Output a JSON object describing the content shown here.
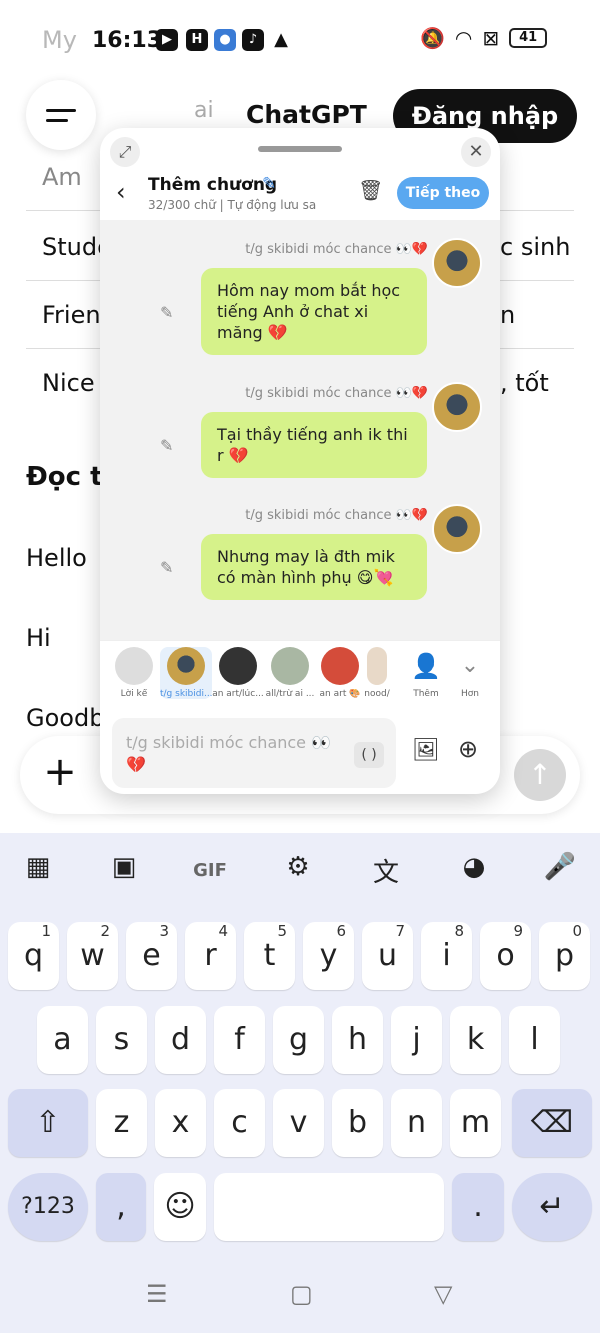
{
  "status": {
    "ghost": "My",
    "time": "16:13",
    "battery": "41",
    "apps": [
      "▶",
      "H",
      "●",
      "♪",
      "▲"
    ]
  },
  "background": {
    "ai_text": "ai",
    "title": "ChatGPT",
    "login_label": "Đăng nhập",
    "rows": [
      {
        "left": "Am",
        "right": ""
      },
      {
        "left": "Stude",
        "right": "c sinh"
      },
      {
        "left": "Frien",
        "right": "n"
      },
      {
        "left": "Nice",
        "right": ", tốt"
      }
    ],
    "section_title": "Đọc t",
    "words": [
      "Hello",
      "Hi",
      "Goodb"
    ]
  },
  "popup": {
    "title": "Thêm chương",
    "subtitle": "32/300 chữ | Tự động lưu sa",
    "next_label": "Tiếp theo",
    "messages": [
      {
        "name": "t/g skibidi móc chance 👀💔",
        "text": "Hôm nay mom bắt học tiếng Anh ở chat xi măng 💔"
      },
      {
        "name": "t/g skibidi móc chance 👀💔",
        "text": "Tại thầy tiếng anh ik thi r 💔"
      },
      {
        "name": "t/g skibidi móc chance 👀💔",
        "text": "Nhưng may là đth mik có màn hình phụ 😋💘"
      }
    ],
    "characters": [
      {
        "label": "Lời kể"
      },
      {
        "label": "t/g skibidi..."
      },
      {
        "label": "an art/lúc..."
      },
      {
        "label": "all/trừ ai ..."
      },
      {
        "label": "an art 🎨"
      },
      {
        "label": "nood/"
      }
    ],
    "add_label": "Thêm",
    "more_label": "Hơn",
    "input_placeholder": "t/g skibidi móc chance 👀 💔",
    "paren": "( )"
  },
  "keyboard": {
    "row1": [
      {
        "k": "q",
        "s": "1"
      },
      {
        "k": "w",
        "s": "2"
      },
      {
        "k": "e",
        "s": "3"
      },
      {
        "k": "r",
        "s": "4"
      },
      {
        "k": "t",
        "s": "5"
      },
      {
        "k": "y",
        "s": "6"
      },
      {
        "k": "u",
        "s": "7"
      },
      {
        "k": "i",
        "s": "8"
      },
      {
        "k": "o",
        "s": "9"
      },
      {
        "k": "p",
        "s": "0"
      }
    ],
    "row2": [
      "a",
      "s",
      "d",
      "f",
      "g",
      "h",
      "j",
      "k",
      "l"
    ],
    "row3": [
      "z",
      "x",
      "c",
      "v",
      "b",
      "n",
      "m"
    ],
    "sym_label": "?123",
    "comma": ",",
    "period": "."
  },
  "colors": {
    "bubble": "#d6f28a",
    "accent": "#5aa8f0",
    "keyboard_bg": "#eceef9"
  }
}
